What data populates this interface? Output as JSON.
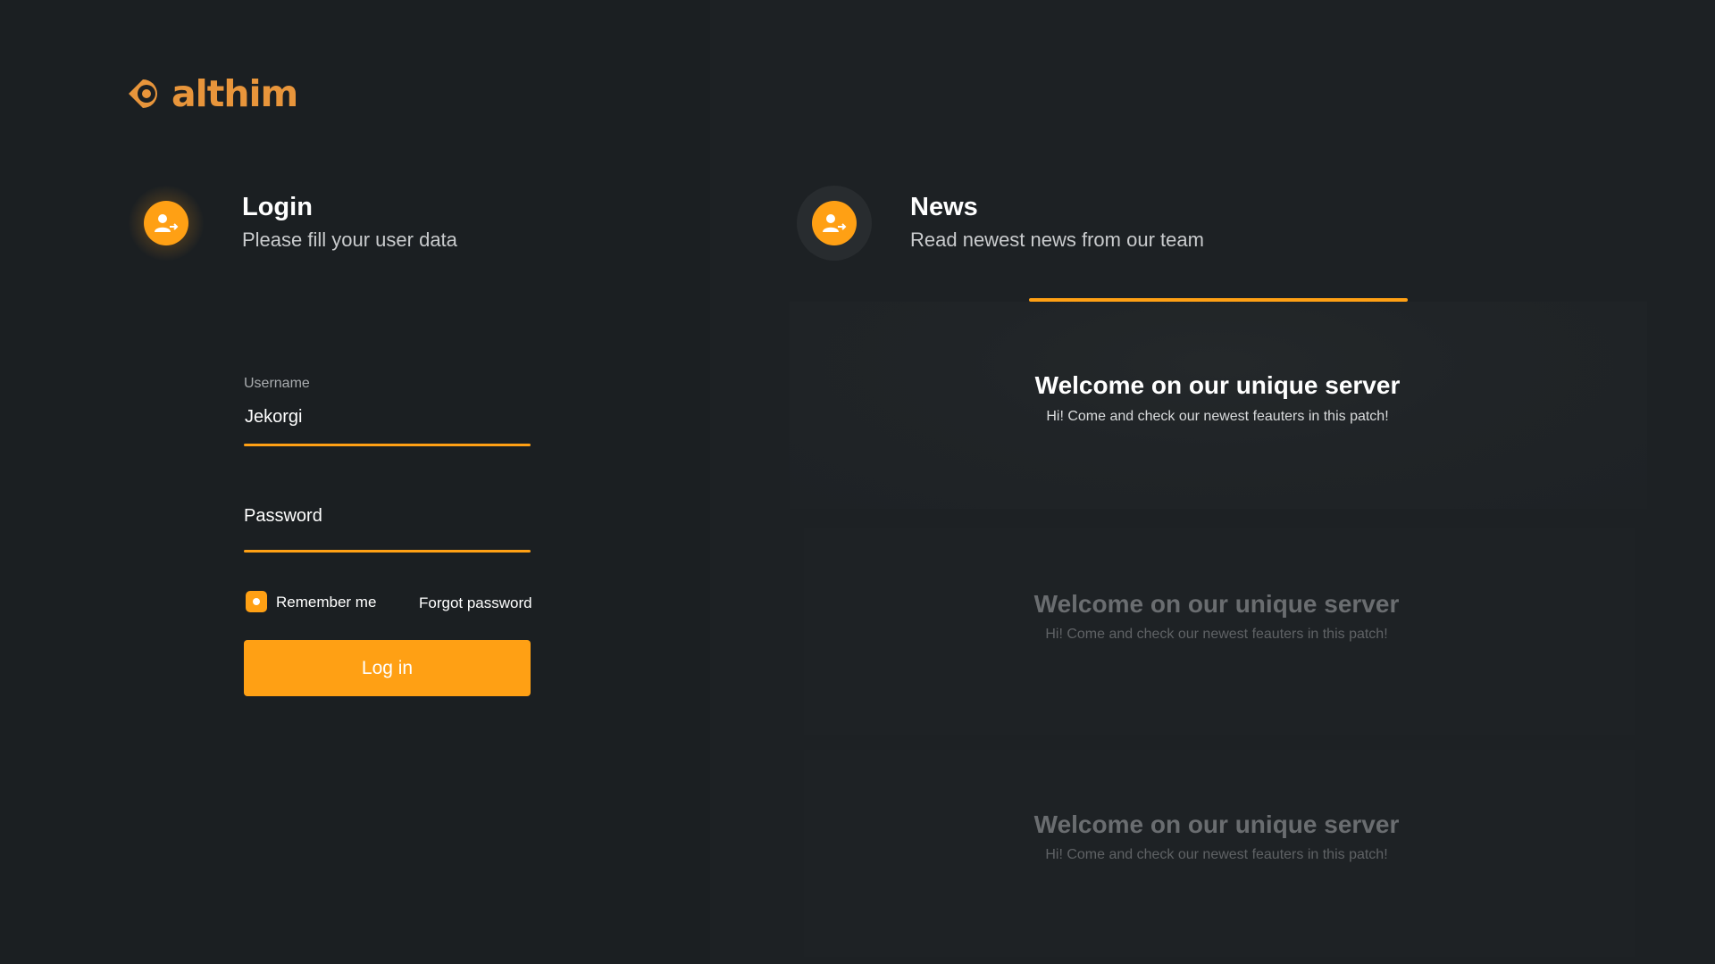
{
  "brand": {
    "name": "althim",
    "color": "#e8953b"
  },
  "accent_color": "#ffa014",
  "login": {
    "icon": "user-login-icon",
    "title": "Login",
    "subtitle": "Please fill your user data",
    "username": {
      "label": "Username",
      "value": "Jekorgi"
    },
    "password": {
      "placeholder": "Password",
      "value": ""
    },
    "remember_me": {
      "label": "Remember me",
      "checked": true
    },
    "forgot_password": "Forgot password",
    "submit": "Log in"
  },
  "news": {
    "icon": "user-login-icon",
    "title": "News",
    "subtitle": "Read newest news from our team",
    "items": [
      {
        "title": "Welcome on our unique server",
        "body": "Hi! Come and check our newest feauters in this patch!",
        "active": true
      },
      {
        "title": "Welcome on our unique server",
        "body": "Hi! Come and check our newest feauters in this patch!",
        "active": false
      },
      {
        "title": "Welcome on our unique server",
        "body": "Hi! Come and check our newest feauters in this patch!",
        "active": false
      }
    ]
  }
}
